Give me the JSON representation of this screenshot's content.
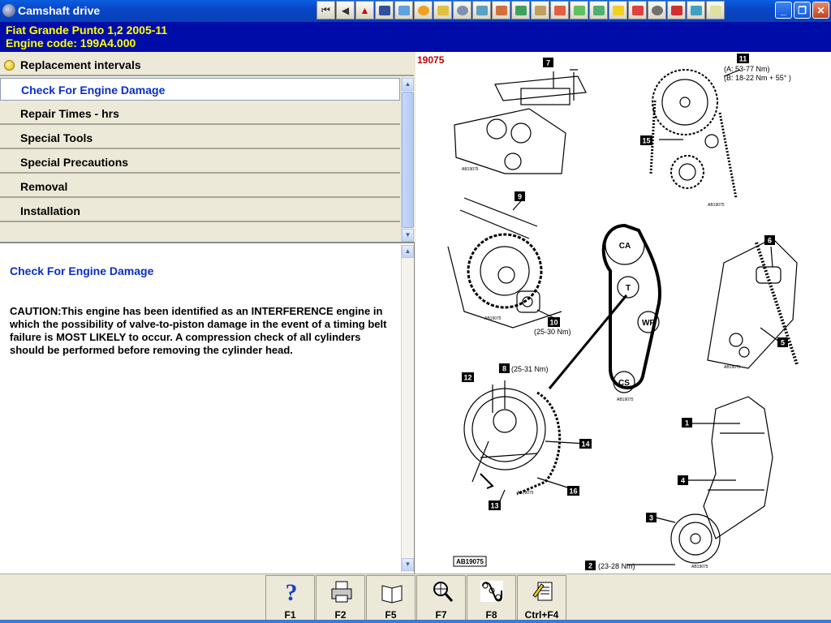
{
  "window": {
    "title": "Camshaft drive"
  },
  "vehicle": {
    "line1": "Fiat   Grande Punto  1,2  2005-11",
    "line2": "Engine code: 199A4.000"
  },
  "menu": {
    "items": [
      "Replacement intervals",
      "Check For Engine Damage",
      "Repair Times - hrs",
      "Special Tools",
      "Special Precautions",
      "Removal",
      "Installation"
    ]
  },
  "content": {
    "title": "Check For Engine Damage",
    "body": "CAUTION:This engine has been identified as an INTERFERENCE engine in which the possibility of valve-to-piston damage in the event of a timing belt failure is MOST LIKELY to occur. A compression check of all cylinders should be performed before removing the cylinder head."
  },
  "diagram": {
    "id": "19075",
    "footer_code": "AB19075",
    "labels": {
      "n1": "1",
      "n2": "2",
      "n3": "3",
      "n4": "4",
      "n5": "5",
      "n6": "6",
      "n7": "7",
      "n8": "8",
      "n9": "9",
      "n10": "10",
      "n11": "11",
      "n12": "12",
      "n13": "13",
      "n14": "14",
      "n15": "15",
      "n16": "16",
      "torque11a": "(A: 53-77 Nm)",
      "torque11b": "(B: 18-22 Nm + 55° )",
      "torque10": "(25-30 Nm)",
      "torque8": "(25-31 Nm)",
      "torque2": "(23-28 Nm)",
      "ca": "CA",
      "t": "T",
      "wp": "WP",
      "cs": "CS",
      "code_small": "AB19075"
    }
  },
  "function_keys": [
    {
      "label": "F1",
      "icon": "help-icon"
    },
    {
      "label": "F2",
      "icon": "printer-icon"
    },
    {
      "label": "F5",
      "icon": "book-icon"
    },
    {
      "label": "F7",
      "icon": "magnifier-icon"
    },
    {
      "label": "F8",
      "icon": "belt-diagram-icon"
    },
    {
      "label": "Ctrl+F4",
      "icon": "notes-icon"
    }
  ],
  "toolbar_icons": [
    "first-page-icon",
    "back-icon",
    "warning-icon",
    "vehicle-icon",
    "tool1-icon",
    "tool2-icon",
    "tool3-icon",
    "tool4-icon",
    "tool5-icon",
    "tool6-icon",
    "tool7-icon",
    "tool8-icon",
    "tool9-icon",
    "tool10-icon",
    "tool11-icon",
    "tool12-icon",
    "tool13-icon",
    "tool14-icon",
    "tool15-icon",
    "tool16-icon",
    "tool17-icon",
    "tool18-icon",
    "tool19-icon",
    "tool20-icon"
  ],
  "colors": {
    "title_bar": "#0a46c8",
    "vehicle_bar": "#000ca8",
    "vehicle_text": "#ffff00",
    "link_blue": "#0a2ec8",
    "diagram_id": "#c00000"
  }
}
